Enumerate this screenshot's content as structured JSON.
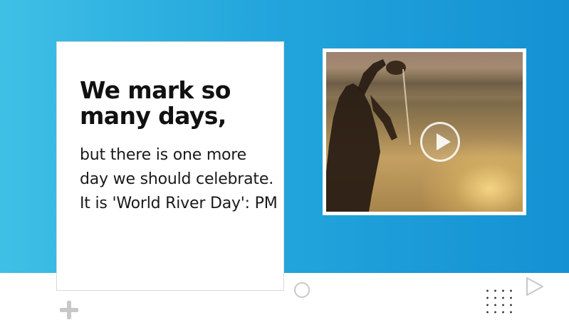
{
  "card": {
    "headline": "We mark so many days,",
    "body": "but there is one more day we should celebrate. It is 'World River Day': PM"
  },
  "video": {
    "thumbnail_icon": "play-icon"
  },
  "decorations": {
    "icons": [
      "circle-outline-icon",
      "plus-icon",
      "dot-grid-icon",
      "triangle-outline-icon"
    ]
  },
  "colors": {
    "hero_gradient_start": "#3ec0e6",
    "hero_gradient_end": "#1491d3",
    "card_background": "#ffffff",
    "text_primary": "#111111",
    "decoration_gray": "#c8c8c8"
  }
}
